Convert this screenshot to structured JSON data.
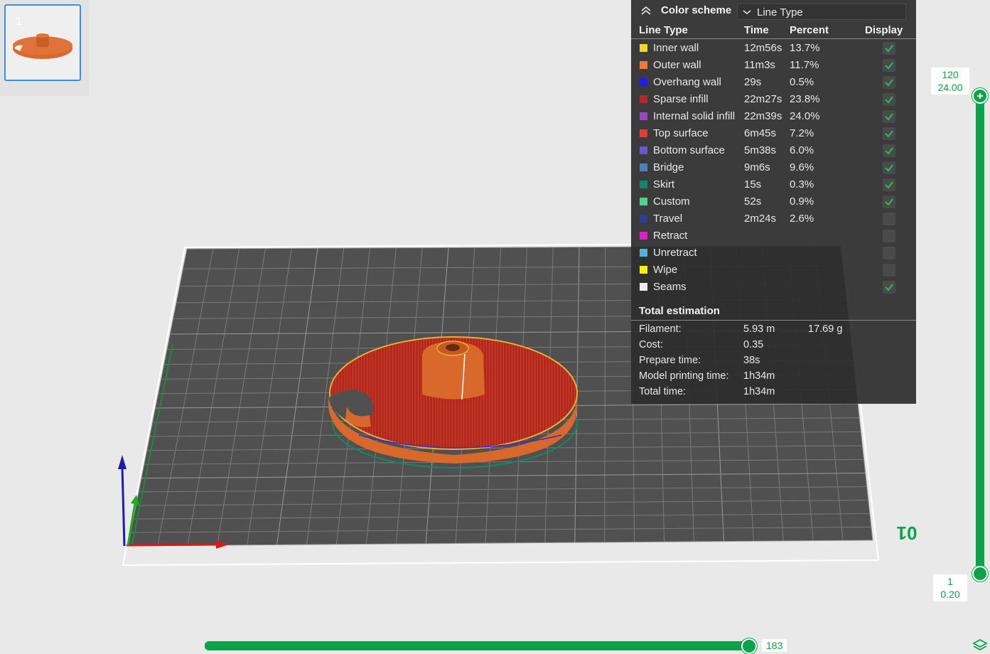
{
  "thumbnail": {
    "number": "1"
  },
  "legend": {
    "header": {
      "title": "Color scheme",
      "selected": "Line Type"
    },
    "columns": {
      "line_type": "Line Type",
      "time": "Time",
      "percent": "Percent",
      "display": "Display"
    },
    "rows": [
      {
        "name": "Inner wall",
        "time": "12m56s",
        "percent": "13.7%",
        "color": "#f5d32a",
        "checked": true
      },
      {
        "name": "Outer wall",
        "time": "11m3s",
        "percent": "11.7%",
        "color": "#f07a3c",
        "checked": true
      },
      {
        "name": "Overhang wall",
        "time": "29s",
        "percent": "0.5%",
        "color": "#1c1cf5",
        "checked": true
      },
      {
        "name": "Sparse infill",
        "time": "22m27s",
        "percent": "23.8%",
        "color": "#b3292c",
        "checked": true
      },
      {
        "name": "Internal solid infill",
        "time": "22m39s",
        "percent": "24.0%",
        "color": "#9b45c8",
        "checked": true
      },
      {
        "name": "Top surface",
        "time": "6m45s",
        "percent": "7.2%",
        "color": "#e33a3a",
        "checked": true
      },
      {
        "name": "Bottom surface",
        "time": "5m38s",
        "percent": "6.0%",
        "color": "#6a55d6",
        "checked": true
      },
      {
        "name": "Bridge",
        "time": "9m6s",
        "percent": "9.6%",
        "color": "#4d7fc2",
        "checked": true
      },
      {
        "name": "Skirt",
        "time": "15s",
        "percent": "0.3%",
        "color": "#0e8a6a",
        "checked": true
      },
      {
        "name": "Custom",
        "time": "52s",
        "percent": "0.9%",
        "color": "#4fd38a",
        "checked": true
      },
      {
        "name": "Travel",
        "time": "2m24s",
        "percent": "2.6%",
        "color": "#2a3e9a",
        "checked": false
      },
      {
        "name": "Retract",
        "time": "",
        "percent": "",
        "color": "#d922c9",
        "checked": false
      },
      {
        "name": "Unretract",
        "time": "",
        "percent": "",
        "color": "#4fb2d9",
        "checked": false
      },
      {
        "name": "Wipe",
        "time": "",
        "percent": "",
        "color": "#f2f20a",
        "checked": false
      },
      {
        "name": "Seams",
        "time": "",
        "percent": "",
        "color": "#ececec",
        "checked": true
      }
    ],
    "total": {
      "title": "Total estimation",
      "filament_label": "Filament:",
      "filament_length": "5.93 m",
      "filament_weight": "17.69 g",
      "cost_label": "Cost:",
      "cost": "0.35",
      "prepare_label": "Prepare time:",
      "prepare": "38s",
      "model_label": "Model printing time:",
      "model": "1h34m",
      "total_label": "Total time:",
      "total": "1h34m"
    }
  },
  "layer_slider": {
    "top_layer": "120",
    "top_height": "24.00",
    "bottom_layer": "1",
    "bottom_height": "0.20"
  },
  "move_slider": {
    "value": "183"
  },
  "bed_label": "01",
  "colors": {
    "accent": "#0aa34a",
    "model": "#d8692a"
  }
}
